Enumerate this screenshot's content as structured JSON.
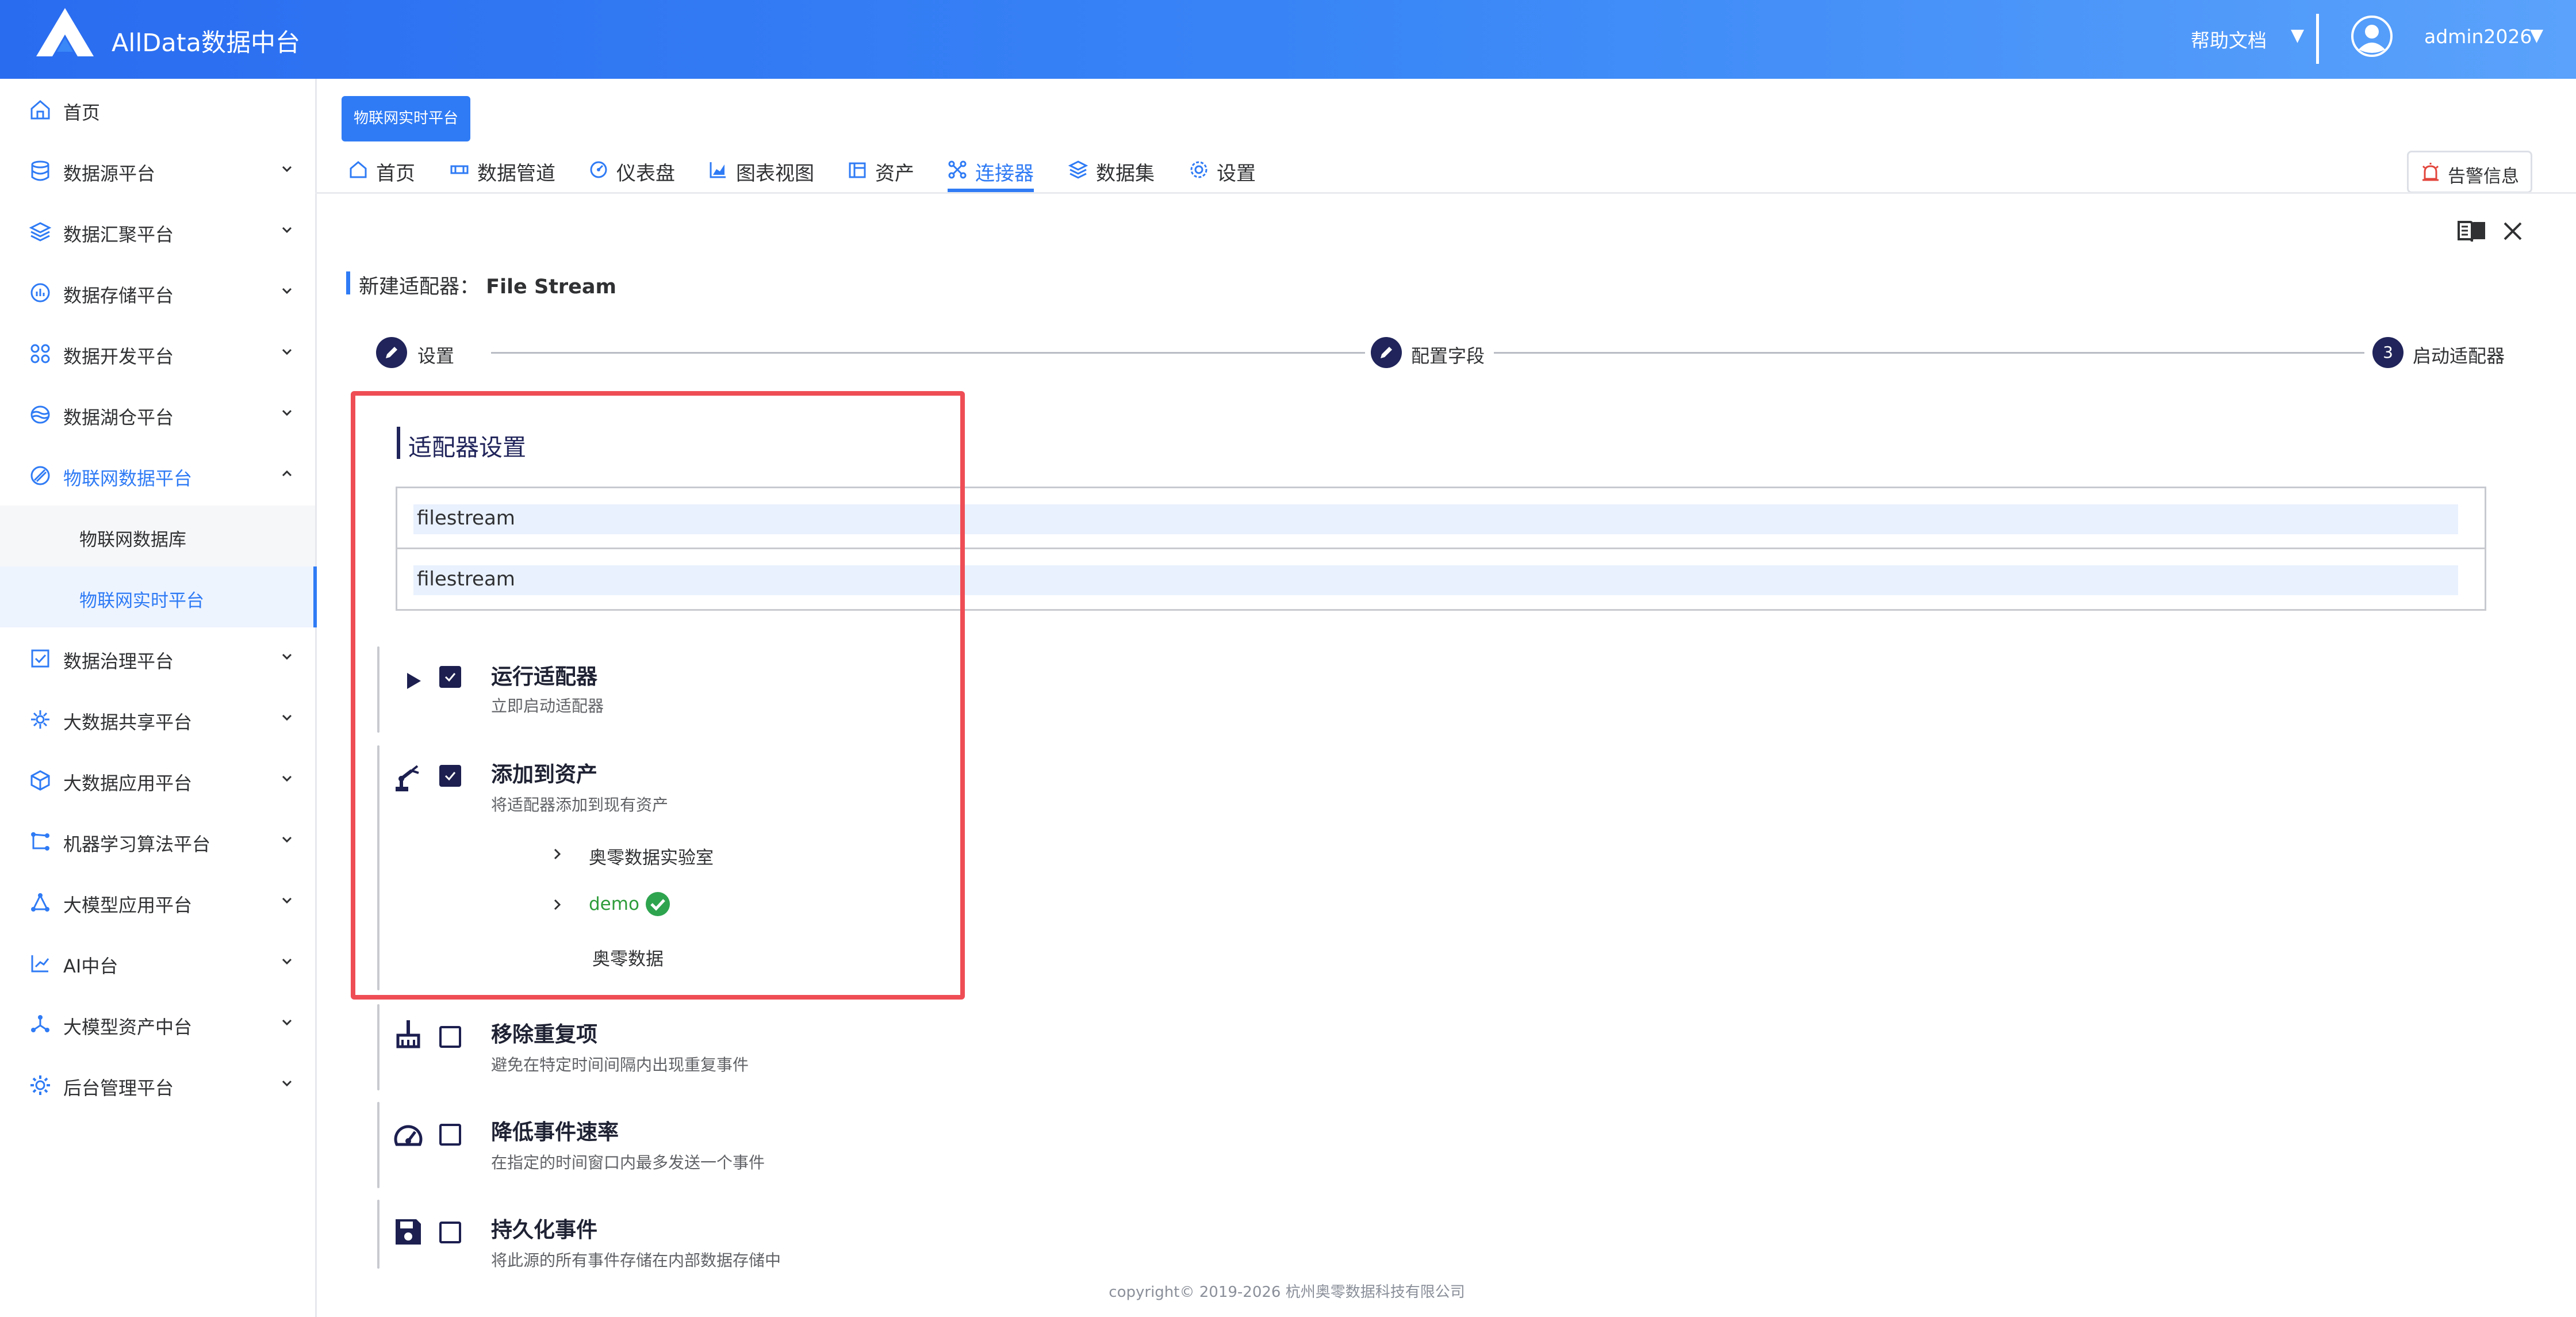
{
  "header": {
    "app_title": "AllData数据中台",
    "help_docs": "帮助文档",
    "help_caret": "▼",
    "username": "admin2026",
    "user_caret": "▼"
  },
  "sidebar": {
    "items": [
      {
        "label": "首页",
        "icon": "home-icon"
      },
      {
        "label": "数据源平台",
        "icon": "database-icon"
      },
      {
        "label": "数据汇聚平台",
        "icon": "layers-icon"
      },
      {
        "label": "数据存储平台",
        "icon": "storage-icon"
      },
      {
        "label": "数据开发平台",
        "icon": "grid-icon"
      },
      {
        "label": "数据湖仓平台",
        "icon": "lake-icon"
      },
      {
        "label": "物联网数据平台",
        "icon": "iot-icon"
      },
      {
        "label": "数据治理平台",
        "icon": "governance-icon"
      },
      {
        "label": "大数据共享平台",
        "icon": "share-icon"
      },
      {
        "label": "大数据应用平台",
        "icon": "cube-icon"
      },
      {
        "label": "机器学习算法平台",
        "icon": "ml-icon"
      },
      {
        "label": "大模型应用平台",
        "icon": "model-icon"
      },
      {
        "label": "AI中台",
        "icon": "ai-icon"
      },
      {
        "label": "大模型资产中台",
        "icon": "model-asset-icon"
      },
      {
        "label": "后台管理平台",
        "icon": "admin-gear-icon"
      }
    ],
    "subitems": [
      {
        "label": "物联网数据库"
      },
      {
        "label": "物联网实时平台"
      }
    ]
  },
  "page_chip": "物联网实时平台",
  "tabs": [
    {
      "label": "首页",
      "icon": "home-icon"
    },
    {
      "label": "数据管道",
      "icon": "pipeline-icon"
    },
    {
      "label": "仪表盘",
      "icon": "dashboard-icon"
    },
    {
      "label": "图表视图",
      "icon": "chart-icon"
    },
    {
      "label": "资产",
      "icon": "asset-icon"
    },
    {
      "label": "连接器",
      "icon": "connector-icon"
    },
    {
      "label": "数据集",
      "icon": "dataset-icon"
    },
    {
      "label": "设置",
      "icon": "settings-icon"
    }
  ],
  "alert_button": "告警信息",
  "form": {
    "title_prefix": "新建适配器：",
    "title_name": "File Stream"
  },
  "stepper": {
    "steps": [
      {
        "label": "设置"
      },
      {
        "label": "配置字段"
      },
      {
        "label": "启动适配器",
        "number": "3"
      }
    ]
  },
  "adapter_settings": {
    "title": "适配器设置",
    "field1_value": "filestream",
    "field2_value": "filestream"
  },
  "options": [
    {
      "title": "运行适配器",
      "desc": "立即启动适配器",
      "checked": true,
      "icon": "play-icon"
    },
    {
      "title": "添加到资产",
      "desc": "将适配器添加到现有资产",
      "checked": true,
      "icon": "robot-arm-icon"
    },
    {
      "title": "移除重复项",
      "desc": "避免在特定时间间隔内出现重复事件",
      "checked": false,
      "icon": "broom-icon"
    },
    {
      "title": "降低事件速率",
      "desc": "在指定的时间窗口内最多发送一个事件",
      "checked": false,
      "icon": "speedometer-icon"
    },
    {
      "title": "持久化事件",
      "desc": "将此源的所有事件存储在内部数据存储中",
      "checked": false,
      "icon": "save-icon"
    }
  ],
  "asset_tree": [
    {
      "label": "奥零数据实验室",
      "has_children": true,
      "selected": false
    },
    {
      "label": "demo",
      "has_children": true,
      "selected": true
    },
    {
      "label": "奥零数据",
      "has_children": false,
      "selected": false
    }
  ],
  "footer": "copyright© 2019-2026 杭州奥零数据科技有限公司"
}
